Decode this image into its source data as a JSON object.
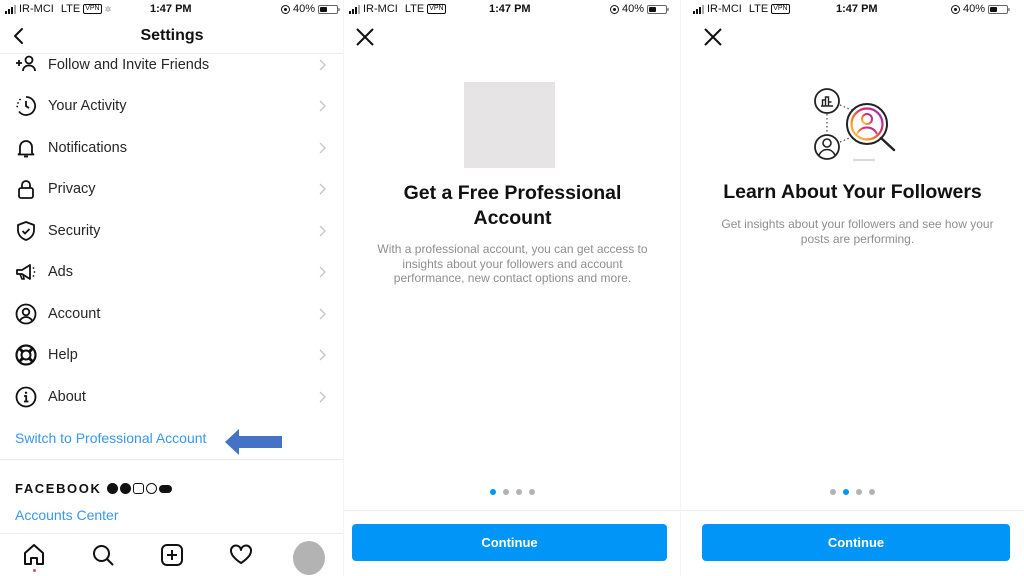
{
  "status_bar": {
    "carrier": "IR-MCI",
    "network": "LTE",
    "vpn_badge": "VPN",
    "time": "1:47 PM",
    "battery": "40%"
  },
  "settings": {
    "title": "Settings",
    "menu": [
      {
        "label": "Follow and Invite Friends",
        "icon": "add-person-icon"
      },
      {
        "label": "Your Activity",
        "icon": "activity-clock-icon"
      },
      {
        "label": "Notifications",
        "icon": "bell-icon"
      },
      {
        "label": "Privacy",
        "icon": "lock-icon"
      },
      {
        "label": "Security",
        "icon": "shield-check-icon"
      },
      {
        "label": "Ads",
        "icon": "megaphone-icon"
      },
      {
        "label": "Account",
        "icon": "account-circle-icon"
      },
      {
        "label": "Help",
        "icon": "lifebuoy-icon"
      },
      {
        "label": "About",
        "icon": "info-icon"
      }
    ],
    "switch_link": "Switch to Professional Account",
    "facebook_label": "FACEBOOK",
    "accounts_center": "Accounts Center",
    "tabbar": [
      "home-icon",
      "search-icon",
      "new-post-icon",
      "heart-icon",
      "profile-avatar"
    ]
  },
  "onboarding_1": {
    "title": "Get a Free Professional Account",
    "title_line1": "Get a Free Professional",
    "title_line2": "Account",
    "description": "With a professional account, you can get access to insights about your followers and account performance, new contact options and more.",
    "page_index": 1,
    "page_count": 4,
    "button": "Continue"
  },
  "onboarding_2": {
    "title": "Learn About Your Followers",
    "description": "Get insights about your followers and see how your posts are performing.",
    "page_index": 2,
    "page_count": 4,
    "button": "Continue"
  },
  "colors": {
    "accent": "#0095f6",
    "link": "#3897f0",
    "annotation_arrow": "#4472c4",
    "placeholder": "#e6e4e5"
  }
}
